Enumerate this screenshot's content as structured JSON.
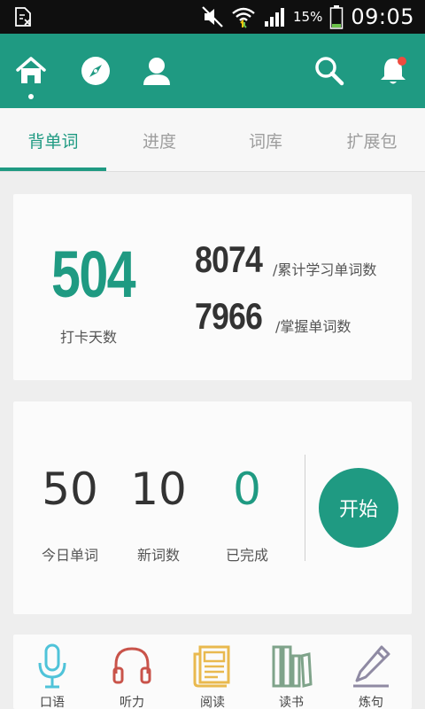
{
  "statusbar": {
    "battery_percent": "15%",
    "time": "09:05"
  },
  "appbar": {
    "icons": [
      "home-icon",
      "compass-icon",
      "profile-icon",
      "search-icon",
      "bell-icon"
    ]
  },
  "tabs": [
    {
      "label": "背单词",
      "active": true
    },
    {
      "label": "进度",
      "active": false
    },
    {
      "label": "词库",
      "active": false
    },
    {
      "label": "扩展包",
      "active": false
    }
  ],
  "summary": {
    "checkin_days": "504",
    "checkin_label": "打卡天数",
    "total_learned": "8074",
    "total_learned_label": "/累计学习单词数",
    "mastered": "7966",
    "mastered_label": "/掌握单词数"
  },
  "today": {
    "today_words": "50",
    "today_words_label": "今日单词",
    "new_words": "10",
    "new_words_label": "新词数",
    "completed": "0",
    "completed_label": "已完成",
    "start_label": "开始"
  },
  "tools": [
    {
      "label": "口语",
      "icon": "microphone-icon",
      "color": "#4fc3d9"
    },
    {
      "label": "听力",
      "icon": "headphones-icon",
      "color": "#c9534a"
    },
    {
      "label": "阅读",
      "icon": "newspaper-icon",
      "color": "#e9b94e"
    },
    {
      "label": "读书",
      "icon": "books-icon",
      "color": "#7fa38a"
    },
    {
      "label": "炼句",
      "icon": "pencil-icon",
      "color": "#8f8aa3"
    }
  ],
  "colors": {
    "primary": "#1f9a82",
    "statusbar": "#0f0f0f",
    "notification_dot": "#ee4b3f"
  }
}
